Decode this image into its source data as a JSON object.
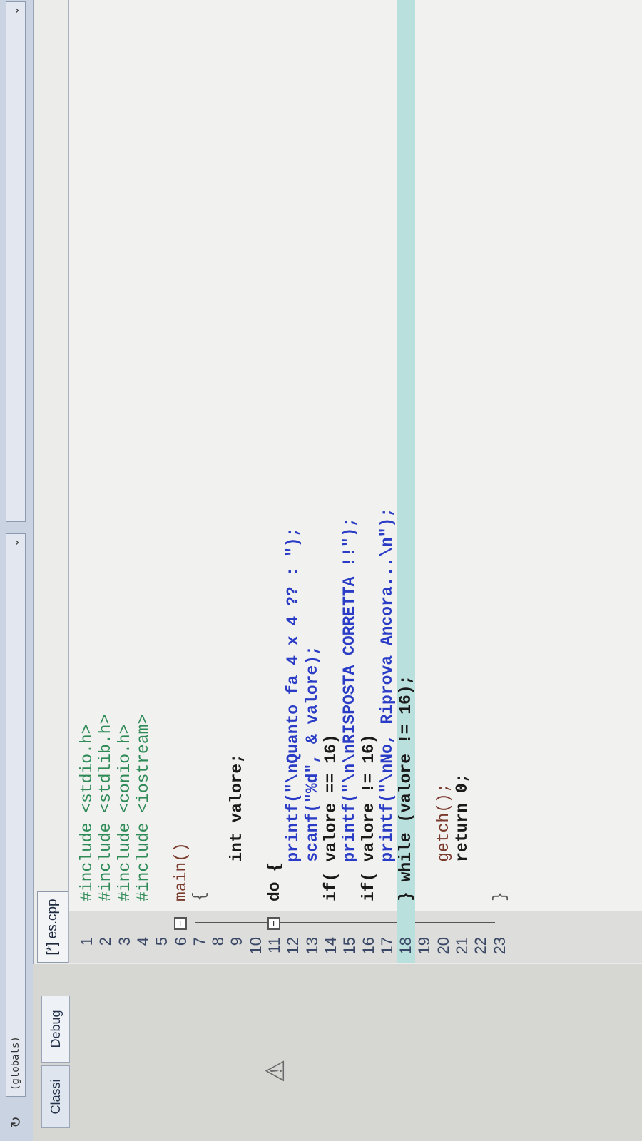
{
  "toolbar": {
    "scope_combo": "(globals)",
    "member_combo": ""
  },
  "left_panel": {
    "tabs": [
      {
        "label": "Classi"
      },
      {
        "label": "Debug"
      }
    ]
  },
  "editor": {
    "tab_label": "[*] es.cpp",
    "highlighted_line": 18,
    "lines": [
      {
        "num": "1",
        "text": "#include <stdio.h>"
      },
      {
        "num": "2",
        "text": "#include <stdlib.h>"
      },
      {
        "num": "3",
        "text": "#include <conio.h>"
      },
      {
        "num": "4",
        "text": "#include <iostream>"
      },
      {
        "num": "5",
        "text": ""
      },
      {
        "num": "6",
        "text": "main()"
      },
      {
        "num": "7",
        "text": "{"
      },
      {
        "num": "8",
        "text": ""
      },
      {
        "num": "9",
        "text": "    int valore;"
      },
      {
        "num": "10",
        "text": ""
      },
      {
        "num": "11",
        "text": "do {"
      },
      {
        "num": "12",
        "text": "    printf(\"\\nQuanto fa 4 x 4 ?? : \");"
      },
      {
        "num": "13",
        "text": "    scanf(\"%d\", & valore);"
      },
      {
        "num": "14",
        "text": "if( valore == 16)"
      },
      {
        "num": "15",
        "text": "    printf(\"\\n\\nRISPOSTA CORRETTA !!\");"
      },
      {
        "num": "16",
        "text": "if( valore != 16)"
      },
      {
        "num": "17",
        "text": "    printf(\"\\nNo, Riprova Ancora...\\n\");"
      },
      {
        "num": "18",
        "text": "} while (valore != 16);"
      },
      {
        "num": "19",
        "text": ""
      },
      {
        "num": "20",
        "text": "    getch();"
      },
      {
        "num": "21",
        "text": "    return 0;"
      },
      {
        "num": "22",
        "text": ""
      },
      {
        "num": "23",
        "text": "}"
      }
    ]
  }
}
